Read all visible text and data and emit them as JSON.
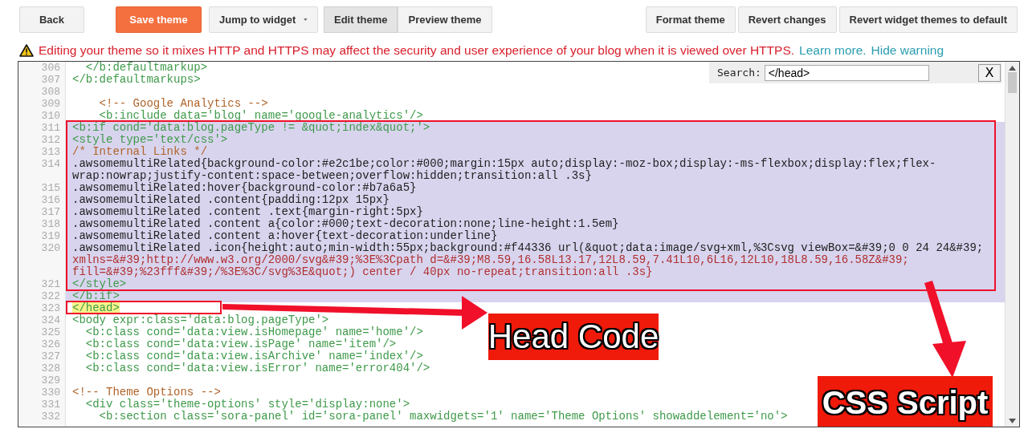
{
  "toolbar": {
    "left": [
      {
        "label": "Back",
        "kind": "plain"
      },
      {
        "label": "Save theme",
        "kind": "primary"
      },
      {
        "label": "Jump to widget",
        "kind": "dropdown"
      }
    ],
    "modes": [
      {
        "label": "Edit theme",
        "selected": true
      },
      {
        "label": "Preview theme",
        "selected": false
      }
    ],
    "right": [
      "Format theme",
      "Revert changes",
      "Revert widget themes to default"
    ]
  },
  "warning": {
    "text": "Editing your theme so it mixes HTTP and HTTPS may affect the security and user experience of your blog when it is viewed over HTTPS.",
    "links": [
      "Learn more.",
      "Hide warning"
    ]
  },
  "editor": {
    "search": {
      "label": "Search:",
      "value": "</head>",
      "close": "X"
    },
    "lines": [
      {
        "number": "306",
        "text": "  </b:defaultmarkup>",
        "kind": "markup",
        "selected": false,
        "match": false
      },
      {
        "number": "307",
        "text": "</b:defaultmarkups>",
        "kind": "markup",
        "selected": false,
        "match": false
      },
      {
        "number": "308",
        "kind": "blank",
        "selected": false,
        "match": false
      },
      {
        "number": "309",
        "text": "    <!-- Google Analytics -->",
        "kind": "comment",
        "selected": false,
        "match": false
      },
      {
        "number": "310",
        "text": "    <b:include data='blog' name='google-analytics'/>",
        "kind": "markup",
        "selected": false,
        "match": false
      },
      {
        "number": "311",
        "text": "<b:if cond='data:blog.pageType != &quot;index&quot;'>",
        "kind": "markup",
        "selected": true,
        "match": false
      },
      {
        "number": "312",
        "text": "<style type='text/css'>",
        "kind": "markup",
        "selected": true,
        "match": false
      },
      {
        "number": "313",
        "text": "/* Internal Links */",
        "kind": "comment",
        "selected": true,
        "match": false
      },
      {
        "number": "314",
        "text": ".awsomemultiRelated{background-color:#e2c1be;color:#000;margin:15px auto;display:-moz-box;display:-ms-flexbox;display:flex;flex-",
        "continued": [
          "wrap:nowrap;justify-content:space-between;overflow:hidden;transition:all .3s}"
        ],
        "kind": "css",
        "selected": true,
        "match": false
      },
      {
        "number": "315",
        "text": ".awsomemultiRelated:hover{background-color:#b7a6a5}",
        "kind": "css",
        "selected": true,
        "match": false
      },
      {
        "number": "316",
        "text": ".awsomemultiRelated .content{padding:12px 15px}",
        "kind": "css",
        "selected": true,
        "match": false
      },
      {
        "number": "317",
        "text": ".awsomemultiRelated .content .text{margin-right:5px}",
        "kind": "css",
        "selected": true,
        "match": false
      },
      {
        "number": "318",
        "text": ".awsomemultiRelated .content a{color:#000;text-decoration:none;line-height:1.5em}",
        "kind": "css",
        "selected": true,
        "match": false
      },
      {
        "number": "319",
        "text": ".awsomemultiRelated .content a:hover{text-decoration:underline}",
        "kind": "css",
        "selected": true,
        "match": false
      },
      {
        "number": "320",
        "text": ".awsomemultiRelated .icon{height:auto;min-width:55px;background:#f44336 url(&quot;data:image/svg+xml,%3Csvg viewBox=&#39;0 0 24 24&#39;",
        "continued": [
          "xmlns=&#39;http://www.w3.org/2000/svg&#39;%3E%3Cpath d=&#39;M8.59,16.58L13.17,12L8.59,7.41L10,6L16,12L10,18L8.59,16.58Z&#39;",
          "fill=&#39;%23fff&#39;/%3E%3C/svg%3E&quot;) center / 40px no-repeat;transition:all .3s}"
        ],
        "kind": "css",
        "selected": true,
        "match": false
      },
      {
        "number": "321",
        "text": "</style>",
        "kind": "markup",
        "selected": true,
        "match": false
      },
      {
        "number": "322",
        "text": "</b:if>",
        "kind": "markup",
        "selected": true,
        "match": false
      },
      {
        "number": "323",
        "text": "</head>",
        "kind": "markup",
        "selected": false,
        "match": true
      },
      {
        "number": "324",
        "text": "<body expr:class='data:blog.pageType'>",
        "kind": "markup",
        "selected": false,
        "match": false
      },
      {
        "number": "325",
        "text": "  <b:class cond='data:view.isHomepage' name='home'/>",
        "kind": "markup",
        "selected": false,
        "match": false
      },
      {
        "number": "326",
        "text": "  <b:class cond='data:view.isPage' name='item'/>",
        "kind": "markup",
        "selected": false,
        "match": false
      },
      {
        "number": "327",
        "text": "  <b:class cond='data:view.isArchive' name='index'/>",
        "kind": "markup",
        "selected": false,
        "match": false
      },
      {
        "number": "328",
        "text": "  <b:class cond='data:view.isError' name='error404'/>",
        "kind": "markup",
        "selected": false,
        "match": false
      },
      {
        "number": "329",
        "kind": "blank",
        "selected": false,
        "match": false
      },
      {
        "number": "330",
        "text": "<!-- Theme Options -->",
        "kind": "comment",
        "selected": false,
        "match": false
      },
      {
        "number": "331",
        "text": "  <div class='theme-options' style='display:none'>",
        "kind": "markup",
        "selected": false,
        "match": false
      },
      {
        "number": "332",
        "text": "    <b:section class='sora-panel' id='sora-panel' maxwidgets='1' name='Theme Options' showaddelement='no'>",
        "kind": "markup",
        "selected": false,
        "match": false
      }
    ]
  },
  "annotations": [
    {
      "label": "Head Code",
      "kind": "head"
    },
    {
      "label": "CSS Script",
      "kind": "css"
    }
  ]
}
